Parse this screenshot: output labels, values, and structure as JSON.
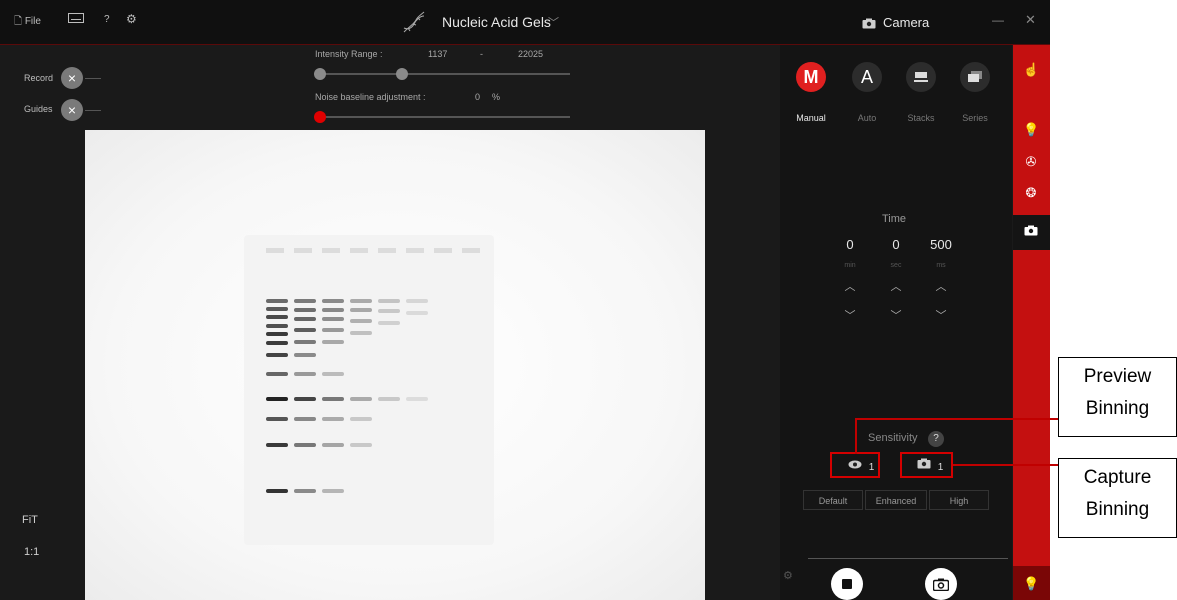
{
  "titlebar": {
    "file_label": "File",
    "help_label": "?",
    "app_title": "Nucleic Acid Gels",
    "panel_title": "Camera",
    "minimize": "—",
    "close": "✕"
  },
  "overlay": {
    "record_label": "Record",
    "guides_label": "Guides",
    "intensity_label": "Intensity Range :",
    "intensity_min": "1137",
    "intensity_sep": "-",
    "intensity_max": "22025",
    "noise_label": "Noise baseline adjustment :",
    "noise_value": "0",
    "noise_unit": "%",
    "fit_label": "FiT",
    "ratio_label": "1:1"
  },
  "modes": [
    {
      "label": "Manual",
      "glyph": "M",
      "active": true
    },
    {
      "label": "Auto",
      "glyph": "A",
      "active": false
    },
    {
      "label": "Stacks",
      "glyph": "▬",
      "active": false
    },
    {
      "label": "Series",
      "glyph": "▬",
      "active": false
    }
  ],
  "time": {
    "title": "Time",
    "values": [
      {
        "value": "0",
        "unit": "min"
      },
      {
        "value": "0",
        "unit": "sec"
      },
      {
        "value": "500",
        "unit": "ms"
      }
    ]
  },
  "sensitivity": {
    "label": "Sensitivity",
    "help": "?",
    "preview_binning": "1",
    "capture_binning": "1",
    "options": [
      "Default",
      "Enhanced",
      "High"
    ]
  },
  "annotations": {
    "preview_line1": "Preview",
    "preview_line2": "Binning",
    "capture_line1": "Capture",
    "capture_line2": "Binning"
  },
  "colors": {
    "accent_red": "#e02020",
    "annotation_red": "#c00000"
  }
}
